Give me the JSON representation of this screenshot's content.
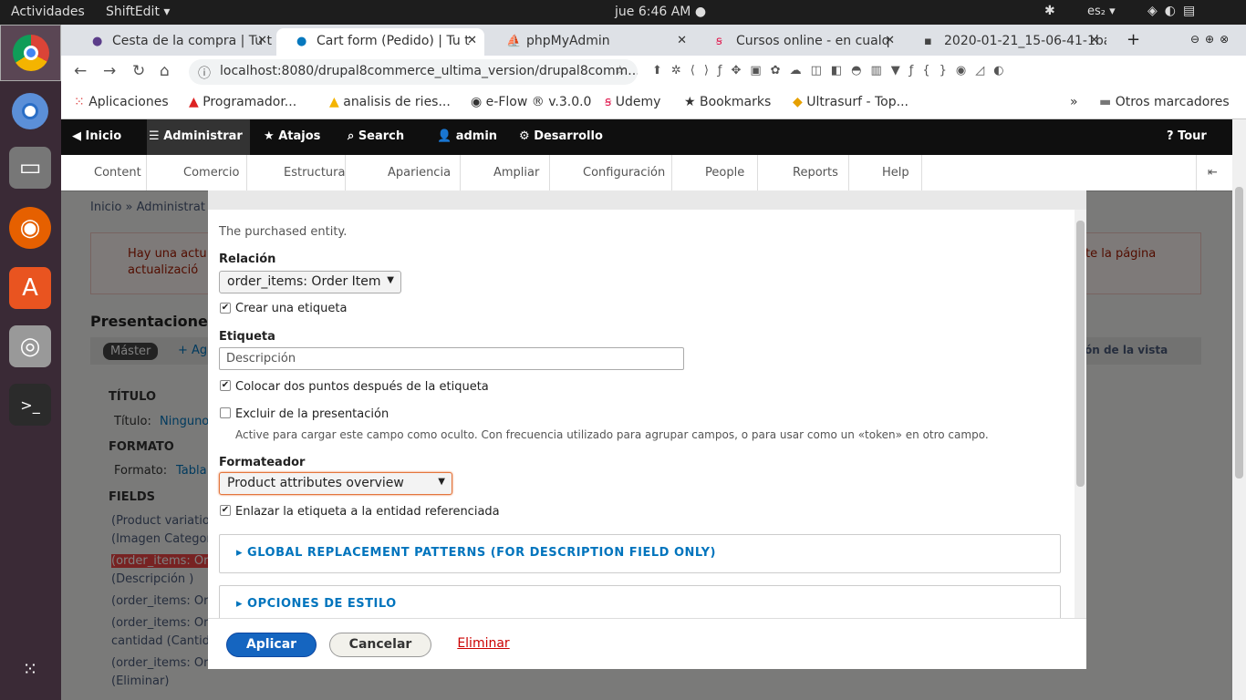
{
  "system": {
    "activities": "Actividades",
    "app": "ShiftEdit ▾",
    "clock": "jue  6:46 AM ●",
    "lang": "es₂ ▾"
  },
  "tabs": [
    {
      "label": "Cesta de la compra | Tu t",
      "close": "✕"
    },
    {
      "label": "Cart form (Pedido) | Tu t",
      "close": "✕"
    },
    {
      "label": "phpMyAdmin",
      "close": "✕"
    },
    {
      "label": "Cursos online - en cualq",
      "close": "✕"
    },
    {
      "label": "2020-01-21_15-06-41-1ba",
      "close": "✕"
    }
  ],
  "address": "localhost:8080/drupal8commerce_ultima_version/drupal8comm...",
  "bookmarks": [
    "Aplicaciones",
    "Programador...",
    "analisis de ries...",
    "e-Flow ® v.3.0.0",
    "Udemy",
    "Bookmarks",
    "Ultrasurf - Top...",
    "»",
    "Otros marcadores"
  ],
  "toolbar": {
    "inicio": "Inicio",
    "administrar": "Administrar",
    "atajos": "Atajos",
    "search": "Search",
    "admin": "admin",
    "desarrollo": "Desarrollo",
    "tour": "Tour"
  },
  "menu": [
    "Content",
    "Comercio",
    "Estructura",
    "Apariencia",
    "Ampliar",
    "Configuración",
    "People",
    "Reports",
    "Help"
  ],
  "background": {
    "breadcrumb": "Inicio » Administrat",
    "error1": "Hay una actu",
    "error2": "actualizació",
    "error_right": "te la página",
    "presentaciones": "Presentacione",
    "master": "Máster",
    "add": "+ Ag",
    "titulo_h": "TÍTULO",
    "titulo": "Título:",
    "titulo_v": "Ninguno",
    "formato_h": "FORMATO",
    "formato": "Formato:",
    "formato_v": "Tabla",
    "fields_h": "FIELDS",
    "f1": "(Product variation",
    "f2": "(Imagen Categori",
    "f3": "(order_items: Ord",
    "f4": "(Descripción )",
    "f5": "(order_items: Ord",
    "f6": "(order_items: Ord",
    "f7": "cantidad (Cantida",
    "f8": "(order_items: Ord",
    "f9": "(Eliminar)",
    "vista": "ón de la vista"
  },
  "dialog": {
    "purchased": "The purchased entity.",
    "relacion_label": "Relación",
    "relacion_value": "order_items: Order Item",
    "crear_etiqueta": "Crear una etiqueta",
    "etiqueta_label": "Etiqueta",
    "etiqueta_value": "Descripción",
    "colocar": "Colocar dos puntos después de la etiqueta",
    "excluir": "Excluir de la presentación",
    "excluir_desc": "Active para cargar este campo como oculto. Con frecuencia utilizado para agrupar campos, o para usar como un «token» en otro campo.",
    "formateador_label": "Formateador",
    "formateador_value": "Product attributes overview",
    "enlazar": "Enlazar la etiqueta a la entidad referenciada",
    "global": "▸ GLOBAL REPLACEMENT PATTERNS (FOR DESCRIPTION FIELD ONLY)",
    "opciones": "▸ OPCIONES DE ESTILO",
    "aplicar": "Aplicar",
    "cancelar": "Cancelar",
    "eliminar": "Eliminar"
  }
}
